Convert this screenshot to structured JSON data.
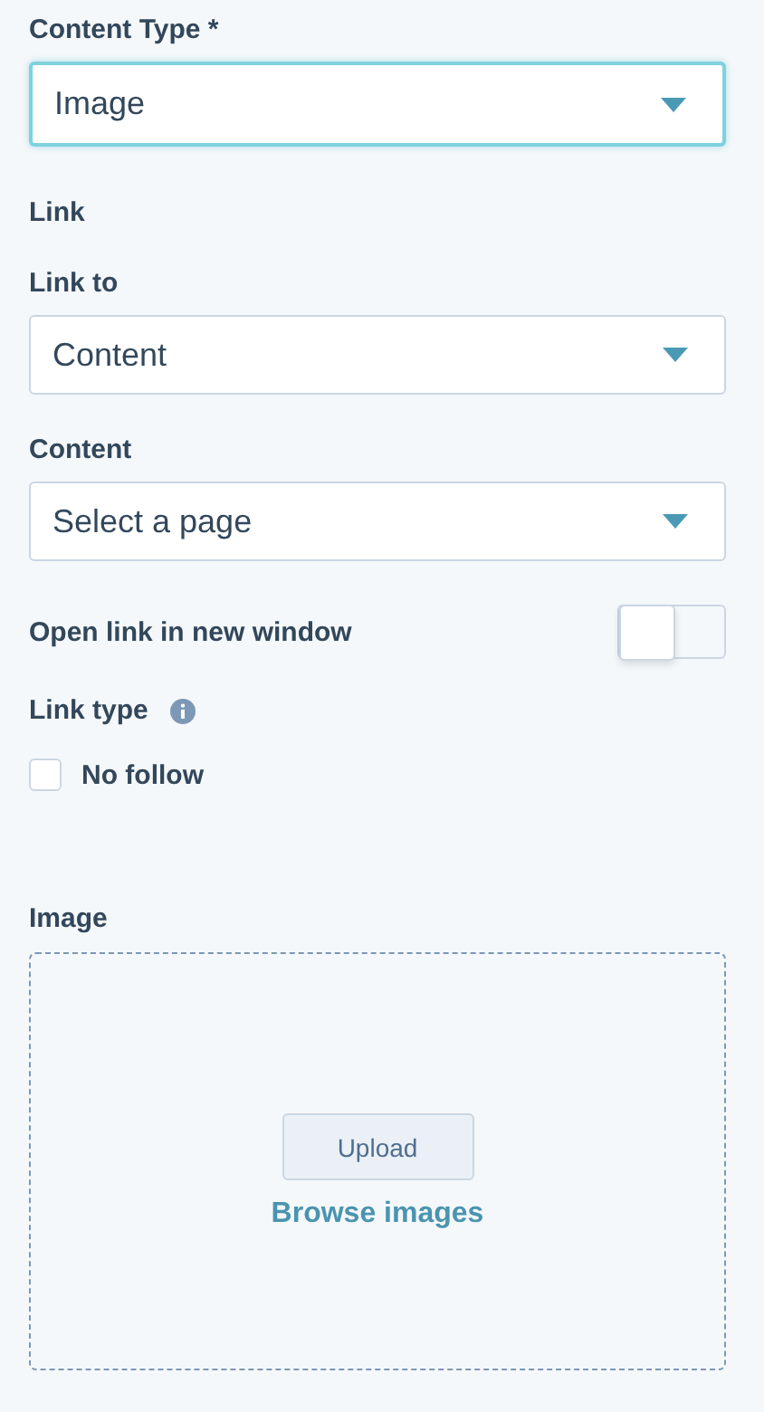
{
  "content_type": {
    "label": "Content Type *",
    "value": "Image",
    "focused": true
  },
  "link_section": {
    "title": "Link"
  },
  "link_to": {
    "label": "Link to",
    "value": "Content",
    "focused": false
  },
  "content": {
    "label": "Content",
    "value": "Select a page",
    "focused": false
  },
  "open_new_window": {
    "label": "Open link in new window",
    "on": false
  },
  "link_type": {
    "label": "Link type",
    "options": [
      {
        "label": "No follow",
        "checked": false
      }
    ]
  },
  "image": {
    "label": "Image",
    "upload_button": "Upload",
    "browse_link": "Browse images"
  }
}
